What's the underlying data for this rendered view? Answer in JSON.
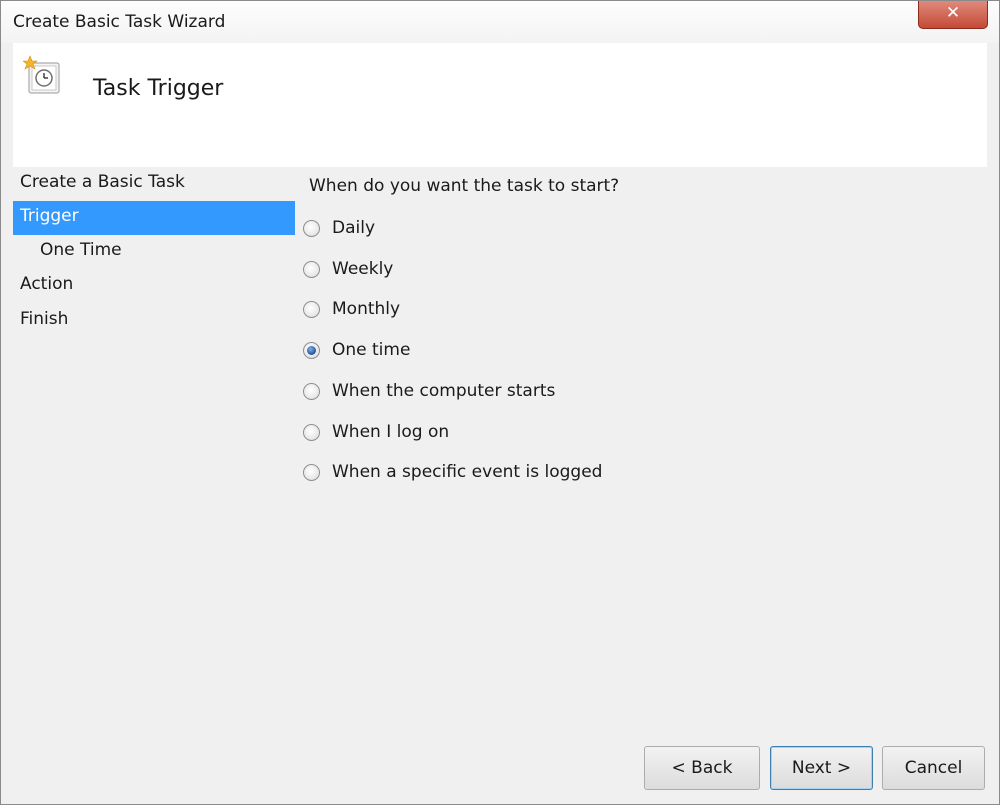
{
  "window": {
    "title": "Create Basic Task Wizard",
    "close_label": "✕"
  },
  "header": {
    "title": "Task Trigger",
    "icon": "task-clock-icon"
  },
  "nav": {
    "items": [
      {
        "label": "Create a Basic Task",
        "selected": false
      },
      {
        "label": "Trigger",
        "selected": true
      },
      {
        "label": "One Time",
        "selected": false
      },
      {
        "label": "Action",
        "selected": false
      },
      {
        "label": "Finish",
        "selected": false
      }
    ]
  },
  "content": {
    "question": "When do you want the task to start?",
    "options": [
      {
        "label": "Daily",
        "checked": false
      },
      {
        "label": "Weekly",
        "checked": false
      },
      {
        "label": "Monthly",
        "checked": false
      },
      {
        "label": "One time",
        "checked": true
      },
      {
        "label": "When the computer starts",
        "checked": false
      },
      {
        "label": "When I log on",
        "checked": false
      },
      {
        "label": "When a specific event is logged",
        "checked": false
      }
    ]
  },
  "buttons": {
    "back": "< Back",
    "next": "Next >",
    "cancel": "Cancel"
  },
  "colors": {
    "selection": "#3399ff",
    "close_button": "#c44a36"
  }
}
